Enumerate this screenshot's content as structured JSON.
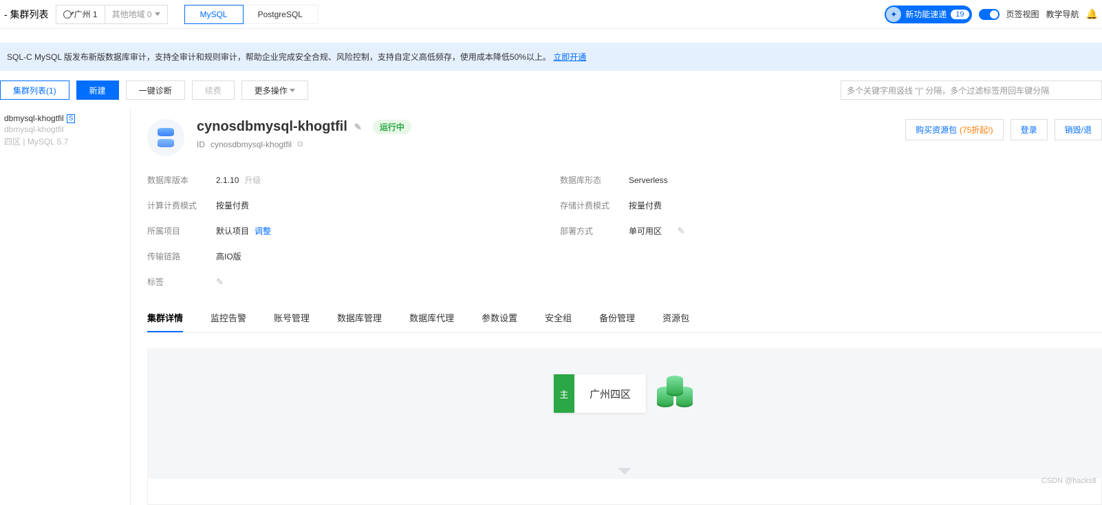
{
  "header": {
    "page_title": "- 集群列表",
    "region_current": "广州 1",
    "region_other": "其他地域 0",
    "db_tabs": [
      "MySQL",
      "PostgreSQL"
    ],
    "new_feature": "新功能速递",
    "new_feature_badge": "19",
    "tab_view": "页签视图",
    "tutorial": "教学导航"
  },
  "banner": {
    "text": "SQL-C MySQL 版发布新版数据库审计，支持全审计和规则审计，帮助企业完成安全合规、风险控制，支持自定义高低频存，使用成本降低50%以上。",
    "link": "立即开通"
  },
  "toolbar": {
    "list_tab": "集群列表(1)",
    "new": "新建",
    "diag": "一键诊断",
    "renew": "续费",
    "more": "更多操作",
    "search_ph": "多个关键字用竖线 \"|\" 分隔，多个过滤标签用回车键分隔"
  },
  "side": {
    "name": "dbmysql-khogtfil",
    "badge": "S",
    "id": "dbmysql-khogtfil",
    "meta": "四区 | MySQL 5.7"
  },
  "cluster": {
    "name": "cynosdbmysql-khogtfil",
    "status": "运行中",
    "id_label": "ID",
    "id": "cynosdbmysql-khogtfil",
    "actions": {
      "buy": "购买资源包",
      "discount": "(75折起!)",
      "login": "登录",
      "destroy": "销毁/退"
    },
    "rows": {
      "db_ver_l": "数据库版本",
      "db_ver_v": "2.1.10",
      "upgrade": "升级",
      "form_l": "数据库形态",
      "form_v": "Serverless",
      "comp_bill_l": "计算计费模式",
      "comp_bill_v": "按量付费",
      "stor_bill_l": "存储计费模式",
      "stor_bill_v": "按量付费",
      "proj_l": "所属项目",
      "proj_v": "默认项目",
      "adjust": "调整",
      "deploy_l": "部署方式",
      "deploy_v": "单可用区",
      "link_l": "传输链路",
      "link_v": "高IO版",
      "tag_l": "标签"
    },
    "tabs": [
      "集群详情",
      "监控告警",
      "账号管理",
      "数据库管理",
      "数据库代理",
      "参数设置",
      "安全组",
      "备份管理",
      "资源包"
    ]
  },
  "node": {
    "tag": "主",
    "zone": "广州四区"
  },
  "watermark": "CSDN @hacks8"
}
